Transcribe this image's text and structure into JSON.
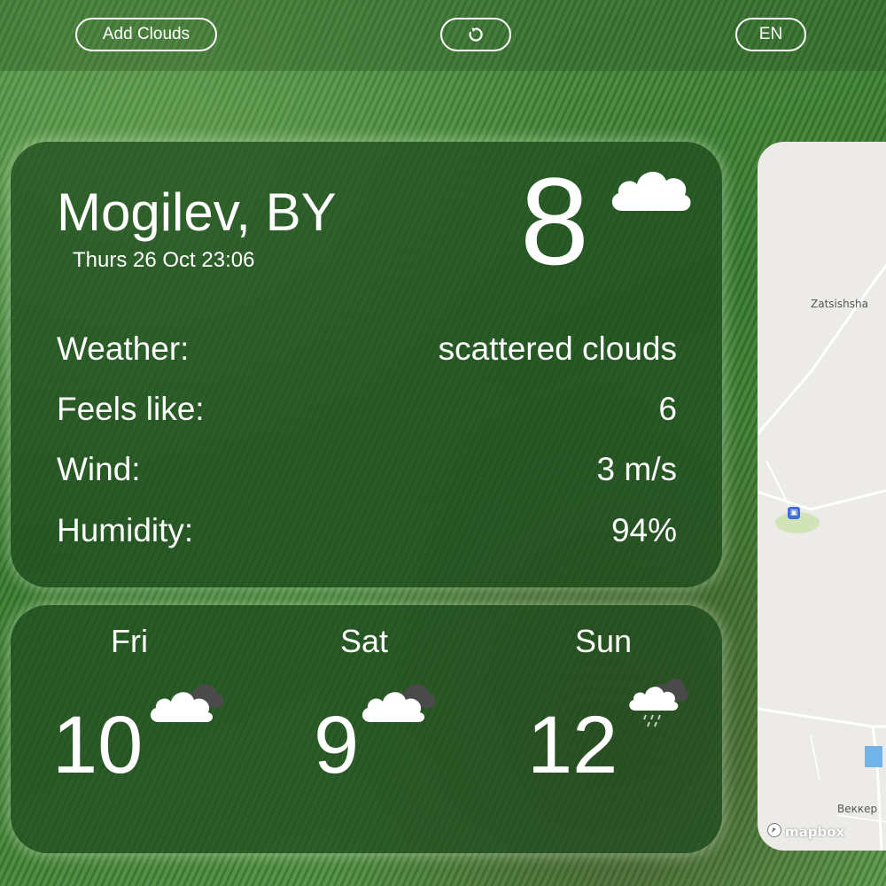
{
  "topbar": {
    "add_clouds_label": "Add Clouds",
    "refresh_icon": "refresh-icon",
    "language_label": "EN"
  },
  "current": {
    "city": "Mogilev, BY",
    "datetime": "Thurs 26 Oct 23:06",
    "temperature": "8",
    "icon": "cloud-icon",
    "details": [
      {
        "label": "Weather:",
        "value": "scattered clouds"
      },
      {
        "label": "Feels like:",
        "value": "6"
      },
      {
        "label": "Wind:",
        "value": "3 m/s"
      },
      {
        "label": "Humidity:",
        "value": "94%"
      }
    ]
  },
  "forecast": [
    {
      "day": "Fri",
      "temp": "10",
      "icon": "broken-clouds-icon"
    },
    {
      "day": "Sat",
      "temp": "9",
      "icon": "broken-clouds-icon"
    },
    {
      "day": "Sun",
      "temp": "12",
      "icon": "rain-cloud-icon"
    }
  ],
  "map": {
    "label_1": "Zatsishsha",
    "label_2": "Веккер",
    "brand": "mapbox"
  },
  "colors": {
    "card_background": "#1e4b1e",
    "map_background": "#ecebe8",
    "text": "#ffffff"
  }
}
